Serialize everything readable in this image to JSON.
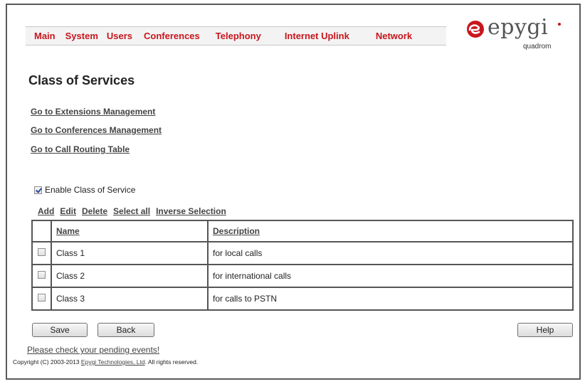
{
  "menu": {
    "items": [
      {
        "label": "Main"
      },
      {
        "label": "System"
      },
      {
        "label": "Users"
      },
      {
        "label": "Conferences"
      },
      {
        "label": "Telephony"
      },
      {
        "label": "Internet Uplink"
      },
      {
        "label": "Network"
      }
    ]
  },
  "brand": {
    "name": "epygi",
    "sub": "quadrom",
    "accent": "#c8161d"
  },
  "page": {
    "title": "Class of Services"
  },
  "links": [
    {
      "label": "Go to Extensions Management"
    },
    {
      "label": "Go to Conferences Management"
    },
    {
      "label": "Go to Call Routing Table"
    }
  ],
  "enable_cos": {
    "label": "Enable Class of Service",
    "checked": true
  },
  "actions": [
    {
      "label": "Add"
    },
    {
      "label": "Edit"
    },
    {
      "label": "Delete"
    },
    {
      "label": "Select all"
    },
    {
      "label": "Inverse Selection"
    }
  ],
  "table": {
    "headers": {
      "name": "Name",
      "description": "Description"
    },
    "rows": [
      {
        "name": "Class 1",
        "description": "for local calls",
        "checked": false
      },
      {
        "name": "Class 2",
        "description": "for international calls",
        "checked": false
      },
      {
        "name": "Class 3",
        "description": "for calls to PSTN",
        "checked": false
      }
    ]
  },
  "buttons": {
    "save": "Save",
    "back": "Back",
    "help": "Help"
  },
  "footer": {
    "pending": "Please check your pending events!",
    "copyright_prefix": "Copyright (C) 2003-2013 ",
    "copyright_link": "Epygi Technologies, Ltd",
    "copyright_suffix": ". All rights reserved."
  }
}
